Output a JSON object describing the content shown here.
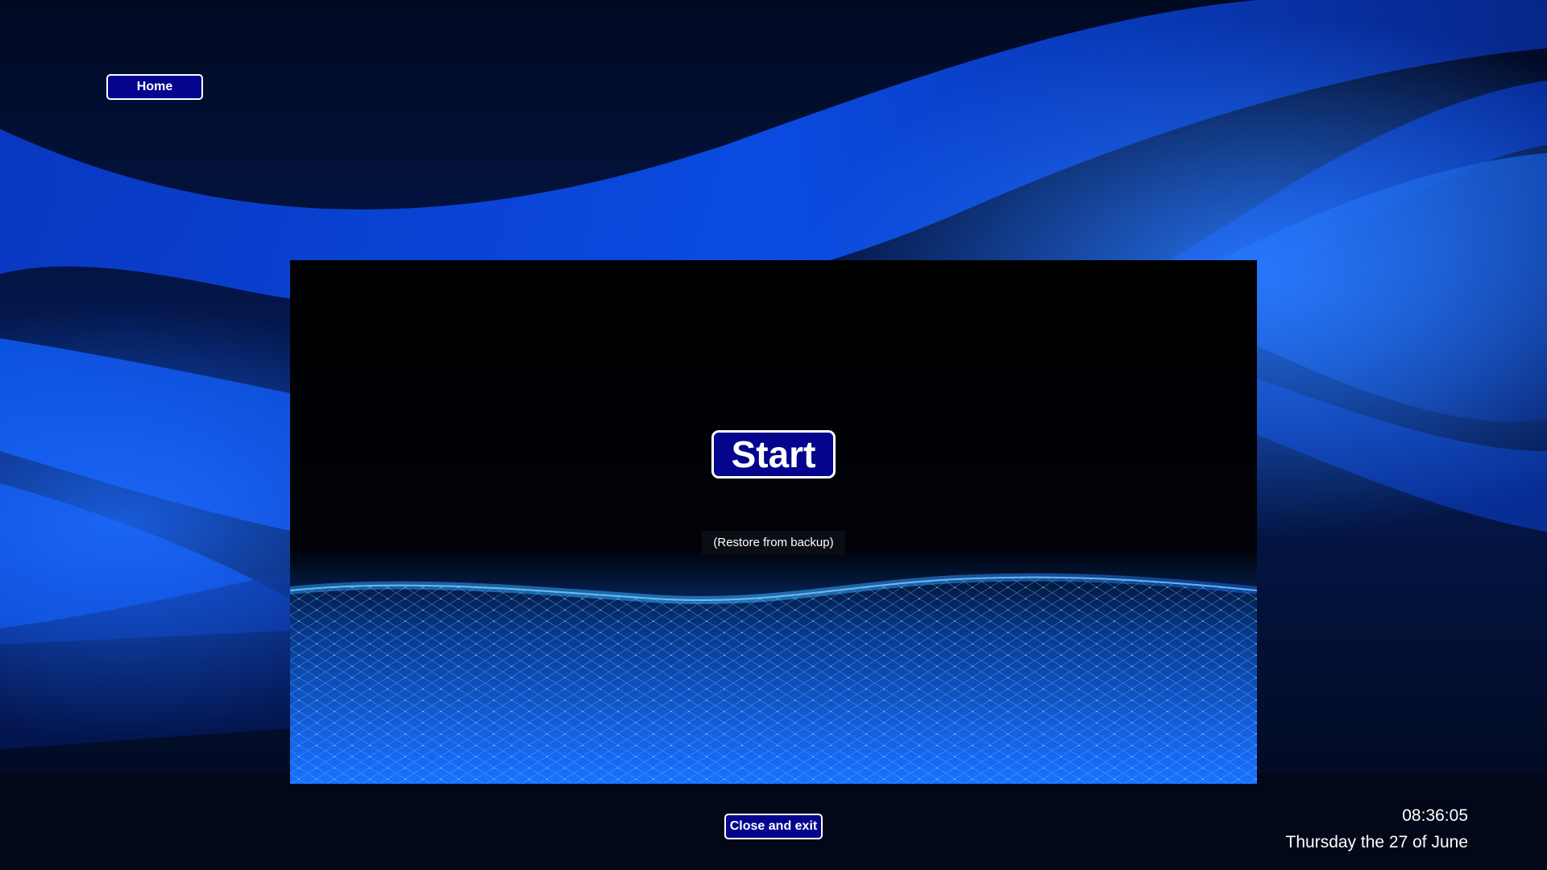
{
  "nav": {
    "home_label": "Home"
  },
  "panel": {
    "start_label": "Start",
    "restore_label": "(Restore from backup)"
  },
  "footer": {
    "close_label": "Close and exit"
  },
  "clock": {
    "time": "08:36:05",
    "date": "Thursday the 27 of June"
  },
  "colors": {
    "button_bg": "#04048c",
    "button_border": "#ffffff",
    "wallpaper_dark": "#020818",
    "wallpaper_accent": "#1466ff",
    "panel_bg": "#000000",
    "mesh_glow": "#1a8fff"
  },
  "icons": {
    "wallpaper": "blue-wave-wallpaper",
    "panel_art": "blue-particle-mesh"
  }
}
